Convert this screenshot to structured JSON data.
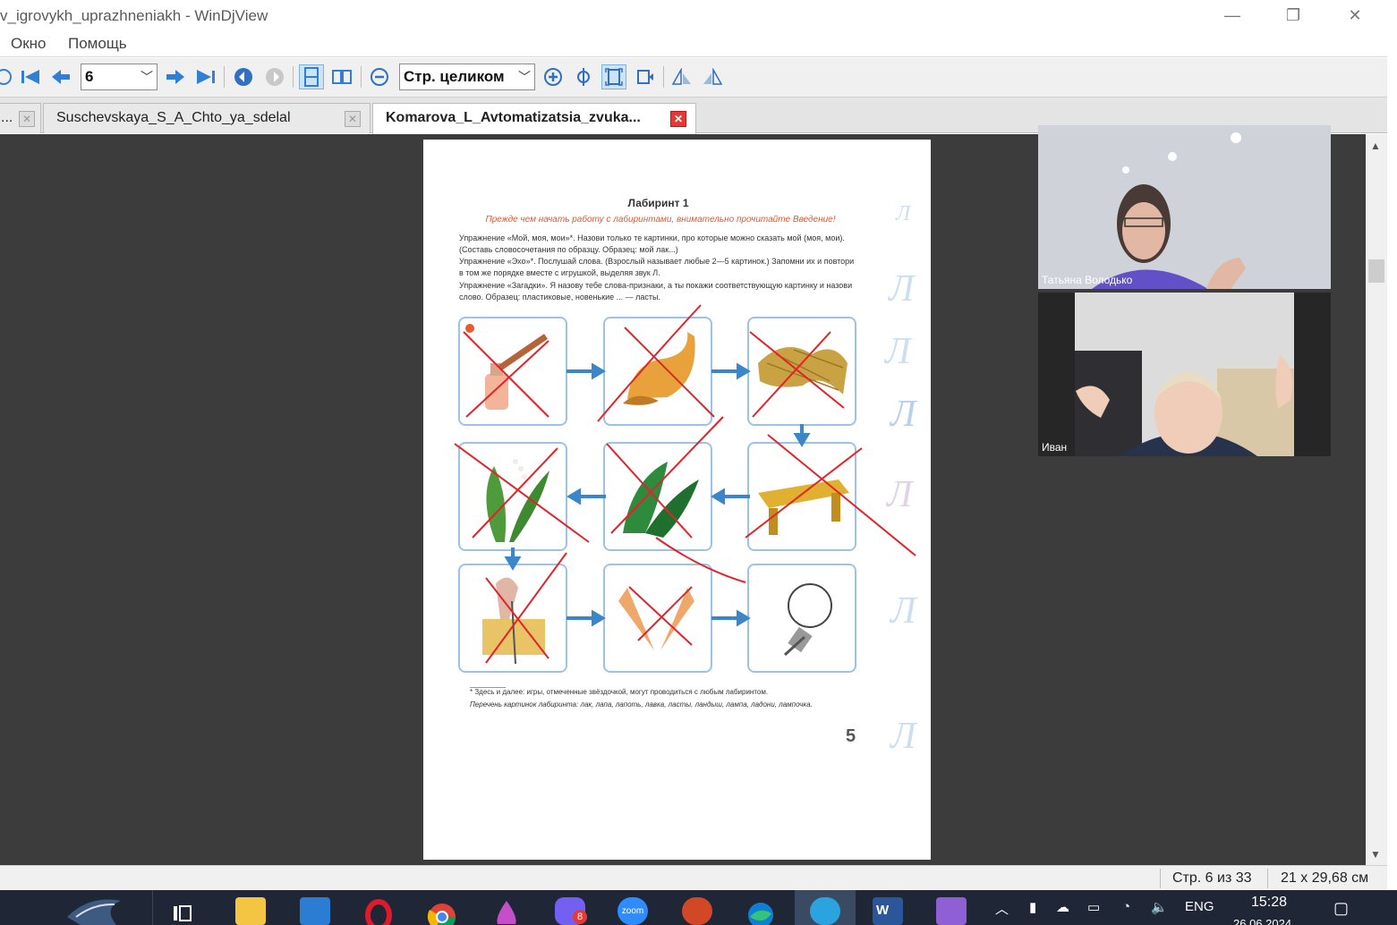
{
  "window": {
    "title": "v_igrovykh_uprazhneniakh - WinDjView",
    "minimize_glyph": "—",
    "maximize_glyph": "❐",
    "close_glyph": "✕"
  },
  "menu": {
    "items": [
      "Окно",
      "Помощь"
    ]
  },
  "toolbar": {
    "page_input": "6",
    "zoom_mode": "Стр. целиком"
  },
  "tabs": [
    {
      "label": "..."
    },
    {
      "label": "Suschevskaya_S_A_Chto_ya_sdelal"
    },
    {
      "label": "Komarova_L_Avtomatizatsia_zvuka...",
      "active": true
    }
  ],
  "document": {
    "title": "Лабиринт 1",
    "subtitle": "Прежде чем начать работу с лабиринтами, внимательно прочитайте Введение!",
    "exercises": [
      "Упражнение «Мой, моя, мои»*. Назови только те картинки, про которые можно сказать мой (моя, мои). (Составь словосочетания по образцу. Образец: мой лак...)",
      "Упражнение «Эхо»*. Послушай слова. (Взрослый называет любые 2—5 картинок.) Запомни их и повтори в том же порядке вместе с игрушкой, выделяя звук Л.",
      "Упражнение «Загадки». Я назову тебе слова-признаки, а ты покажи соответствующую картинку и назови слово. Образец: пластиковые, новенькие ... — ласты."
    ],
    "footnote": "* Здесь и далее: игры, отмеченные звёздочкой, могут проводиться с любым лабиринтом.",
    "word_list": "Перечень картинок лабиринта: лак, лапа, лапоть, лавка, ласты, ландыш, лампа, ладони, лампочка.",
    "page_number": "5"
  },
  "participants": [
    {
      "name": "Татьяна Володько"
    },
    {
      "name": "Иван"
    }
  ],
  "status": {
    "page": "Стр. 6 из 33",
    "size": "21 x 29,68 см"
  },
  "taskbar": {
    "language": "ENG",
    "time": "15:28",
    "date": "26.06.2024",
    "viber_badge": "8",
    "zoom_label": "zoom"
  },
  "colors": {
    "accent_red": "#e53935",
    "strike_red": "#e0242b",
    "arrow_blue": "#3a86c8",
    "doc_bg": "#3c3c3c",
    "taskbar_bg": "#1f2736"
  }
}
